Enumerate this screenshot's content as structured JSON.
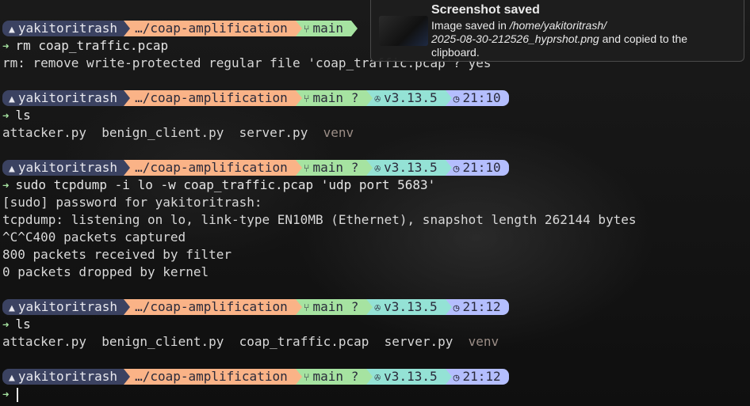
{
  "prompt": {
    "user": "yakitoritrash",
    "path": "…/coap-amplification",
    "branch": "main",
    "git_status": "?",
    "python_version": "v3.13.5"
  },
  "blocks": [
    {
      "time": "",
      "command": "rm coap_traffic.pcap",
      "output": [
        "rm: remove write-protected regular file 'coap_traffic.pcap'? yes"
      ]
    },
    {
      "time": "21:10",
      "command": "ls",
      "ls": [
        "attacker.py",
        "benign_client.py",
        "server.py"
      ],
      "ls_dir": "venv"
    },
    {
      "time": "21:10",
      "command": "sudo tcpdump -i lo -w coap_traffic.pcap 'udp port 5683'",
      "output": [
        "[sudo] password for yakitoritrash:",
        "tcpdump: listening on lo, link-type EN10MB (Ethernet), snapshot length 262144 bytes",
        "^C^C400 packets captured",
        "800 packets received by filter",
        "0 packets dropped by kernel"
      ]
    },
    {
      "time": "21:12",
      "command": "ls",
      "ls": [
        "attacker.py",
        "benign_client.py",
        "coap_traffic.pcap",
        "server.py"
      ],
      "ls_dir": "venv"
    },
    {
      "time": "21:12"
    }
  ],
  "notification": {
    "title": "Screenshot saved",
    "prefix": "Image saved in ",
    "path1": "/home/yakitoritrash/",
    "path2": "2025-08-30-212526_hyprshot.png",
    "suffix": " and copied to the",
    "suffix2": "clipboard."
  },
  "colors": {
    "user_bg": "#3b4261",
    "path_bg": "#fab387",
    "git_bg": "#a6e3a1",
    "python_bg": "#94e2d5",
    "time_bg": "#b4befe",
    "prompt_arrow": "#a6e3a1"
  },
  "icons": {
    "user": "arch-logo-icon",
    "branch": "git-branch-icon",
    "python": "python-icon",
    "time": "clock-icon",
    "prompt": "chevron-right-icon"
  }
}
